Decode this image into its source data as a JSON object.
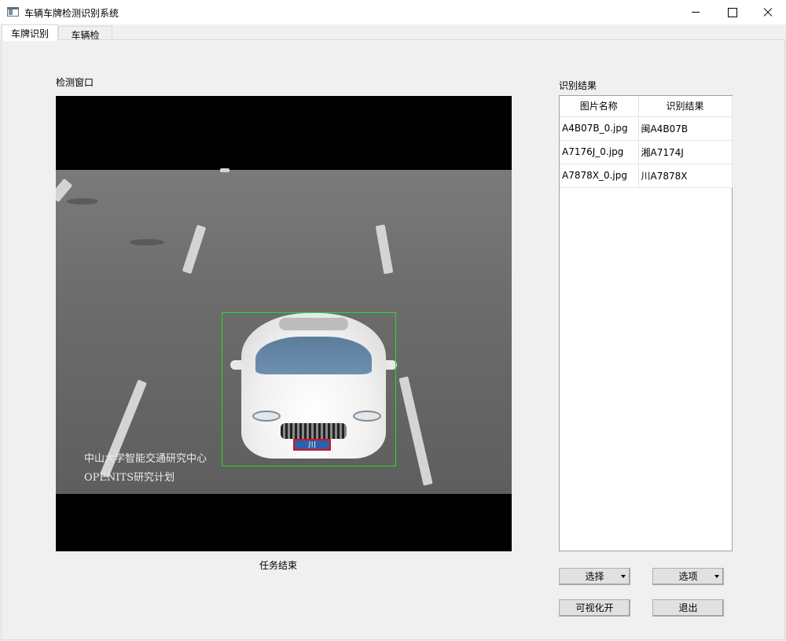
{
  "window": {
    "title": "车辆车牌检测识别系统",
    "icon": "app-window-icon"
  },
  "tabs": [
    {
      "label": "车牌识别",
      "active": true
    },
    {
      "label": "车辆检索",
      "active": false
    }
  ],
  "detection": {
    "section_label": "检测窗口",
    "plate_text": "川A·7878X",
    "watermark_line1": "中山大学智能交通研究中心",
    "watermark_line2": "OPENITS研究计划",
    "status": "任务结束"
  },
  "results": {
    "section_label": "识别结果",
    "columns": [
      "图片名称",
      "识别结果"
    ],
    "rows": [
      {
        "image": "A4B07B_0.jpg",
        "result": "闽A4B07B"
      },
      {
        "image": "A7176J_0.jpg",
        "result": "湘A7174J"
      },
      {
        "image": "A7878X_0.jpg",
        "result": "川A7878X"
      }
    ]
  },
  "buttons": {
    "select": "选择",
    "options": "选项",
    "visualize": "可视化开",
    "exit": "退出"
  },
  "colors": {
    "detect_box": "#22dd22",
    "plate_bg": "#2b5fb0",
    "plate_border": "#dd1111"
  }
}
